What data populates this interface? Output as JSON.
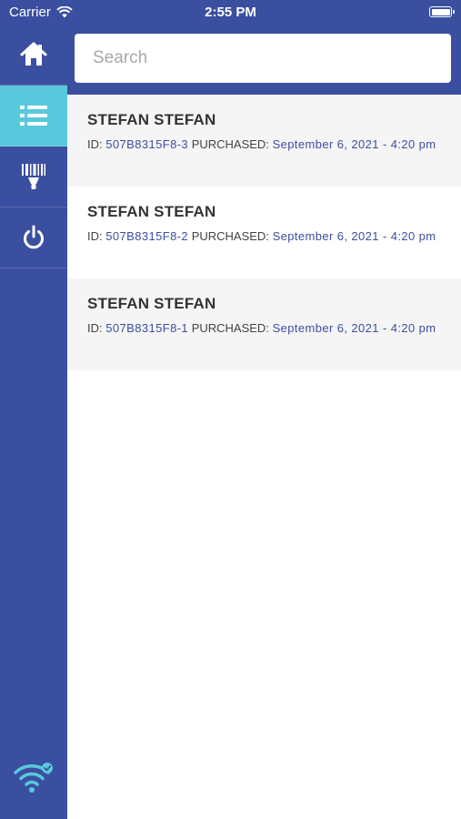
{
  "status_bar": {
    "carrier": "Carrier",
    "time": "2:55 PM"
  },
  "colors": {
    "primary": "#3b4fa0",
    "accent": "#5ac8dc"
  },
  "sidebar": {
    "items": [
      {
        "icon": "home-icon",
        "active": false
      },
      {
        "icon": "list-icon",
        "active": true
      },
      {
        "icon": "barcode-scanner-icon",
        "active": false
      },
      {
        "icon": "power-icon",
        "active": false
      }
    ],
    "footer_icon": "wifi-connected-icon"
  },
  "search": {
    "placeholder": "Search",
    "value": ""
  },
  "orders": [
    {
      "name": "STEFAN STEFAN",
      "id_label": "ID:",
      "id": "507B8315F8-3",
      "purchased_label": "PURCHASED:",
      "date": "September 6, 2021 - 4:20 pm"
    },
    {
      "name": "STEFAN STEFAN",
      "id_label": "ID:",
      "id": "507B8315F8-2",
      "purchased_label": "PURCHASED:",
      "date": "September 6, 2021 - 4:20 pm"
    },
    {
      "name": "STEFAN STEFAN",
      "id_label": "ID:",
      "id": "507B8315F8-1",
      "purchased_label": "PURCHASED:",
      "date": "September 6, 2021 - 4:20 pm"
    }
  ]
}
